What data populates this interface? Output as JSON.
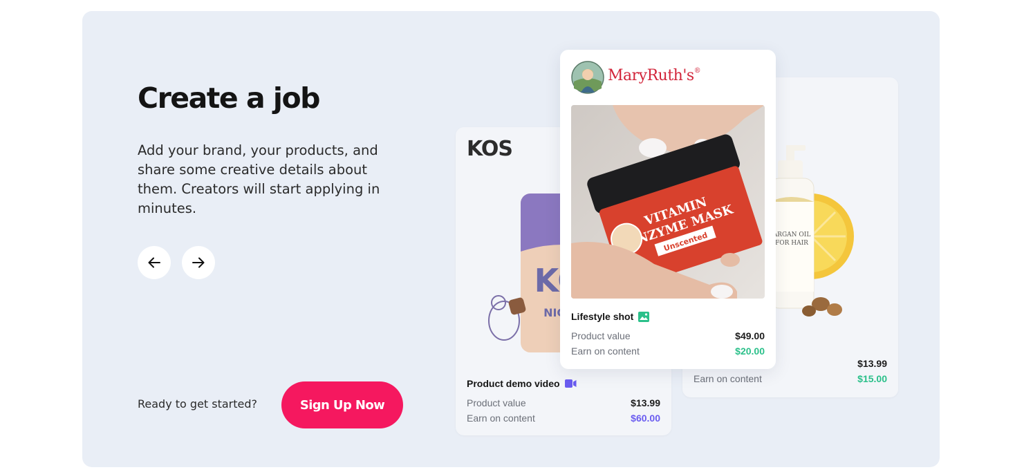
{
  "hero": {
    "title": "Create a job",
    "description": "Add your brand, your products, and share some creative details about them. Creators will start applying in minutes.",
    "prev_icon": "arrow-left-icon",
    "next_icon": "arrow-right-icon"
  },
  "cta": {
    "prompt": "Ready to get started?",
    "button_label": "Sign Up Now",
    "button_color": "#f5185f"
  },
  "cards": {
    "kos": {
      "brand": "KOS",
      "job_type": "Product demo video",
      "job_icon": "video-icon",
      "product_value_label": "Product value",
      "product_value": "$13.99",
      "earn_label": "Earn on content",
      "earn_value": "$60.00"
    },
    "mary": {
      "brand": "MaryRuth's",
      "job_type": "Lifestyle shot",
      "job_icon": "image-icon",
      "product_value_label": "Product value",
      "product_value": "$49.00",
      "earn_label": "Earn on content",
      "earn_value": "$20.00",
      "product_label_line1": "VITAMIN",
      "product_label_line2": "ENZYME MASK",
      "product_label_badge": "Unscented"
    },
    "argan": {
      "product_value": "$13.99",
      "earn_label": "Earn on content",
      "earn_value": "$15.00",
      "product_label": "ARGAN OIL FOR HAIR"
    }
  },
  "colors": {
    "panel_bg": "#e9eef6",
    "earn_green": "#2bc08a",
    "earn_purple": "#6a5cf0"
  }
}
